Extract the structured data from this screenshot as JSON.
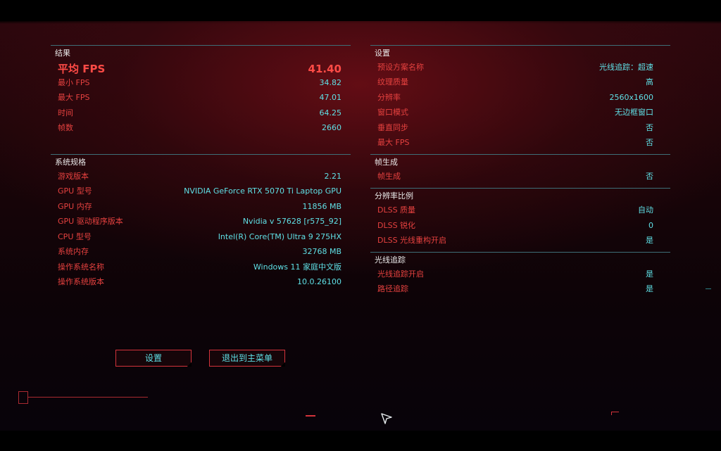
{
  "results": {
    "title": "结果",
    "rows": [
      {
        "label": "平均 FPS",
        "value": "41.40"
      },
      {
        "label": "最小 FPS",
        "value": "34.82"
      },
      {
        "label": "最大 FPS",
        "value": "47.01"
      },
      {
        "label": "时间",
        "value": "64.25"
      },
      {
        "label": "帧数",
        "value": "2660"
      }
    ]
  },
  "specs": {
    "title": "系统规格",
    "rows": [
      {
        "label": "游戏版本",
        "value": "2.21"
      },
      {
        "label": "GPU 型号",
        "value": "NVIDIA GeForce RTX 5070 Ti Laptop GPU"
      },
      {
        "label": "GPU 内存",
        "value": "11856 MB"
      },
      {
        "label": "GPU 驱动程序版本",
        "value": "Nvidia v 57628 [r575_92]"
      },
      {
        "label": "CPU 型号",
        "value": "Intel(R) Core(TM) Ultra 9 275HX"
      },
      {
        "label": "系统内存",
        "value": "32768 MB"
      },
      {
        "label": "操作系统名称",
        "value": "Windows 11 家庭中文版"
      },
      {
        "label": "操作系统版本",
        "value": "10.0.26100"
      }
    ]
  },
  "settings": {
    "title": "设置",
    "rows": [
      {
        "label": "预设方案名称",
        "value": "光线追踪：超速"
      },
      {
        "label": "纹理质量",
        "value": "高"
      },
      {
        "label": "分辨率",
        "value": "2560x1600"
      },
      {
        "label": "窗口模式",
        "value": "无边框窗口"
      },
      {
        "label": "垂直同步",
        "value": "否"
      },
      {
        "label": "最大 FPS",
        "value": "否"
      }
    ]
  },
  "frame_gen": {
    "title": "帧生成",
    "rows": [
      {
        "label": "帧生成",
        "value": "否"
      }
    ]
  },
  "res_scale": {
    "title": "分辨率比例",
    "rows": [
      {
        "label": "DLSS 质量",
        "value": "自动"
      },
      {
        "label": "DLSS 锐化",
        "value": "0"
      },
      {
        "label": "DLSS 光线重构开启",
        "value": "是"
      }
    ]
  },
  "ray_tracing": {
    "title": "光线追踪",
    "rows": [
      {
        "label": "光线追踪开启",
        "value": "是"
      },
      {
        "label": "路径追踪",
        "value": "是"
      }
    ]
  },
  "buttons": {
    "settings": "设置",
    "exit_main_menu": "退出到主菜单"
  },
  "colors": {
    "label_red": "#e5413f",
    "value_cyan": "#5fe0e6",
    "divider": "#3e6f78"
  }
}
